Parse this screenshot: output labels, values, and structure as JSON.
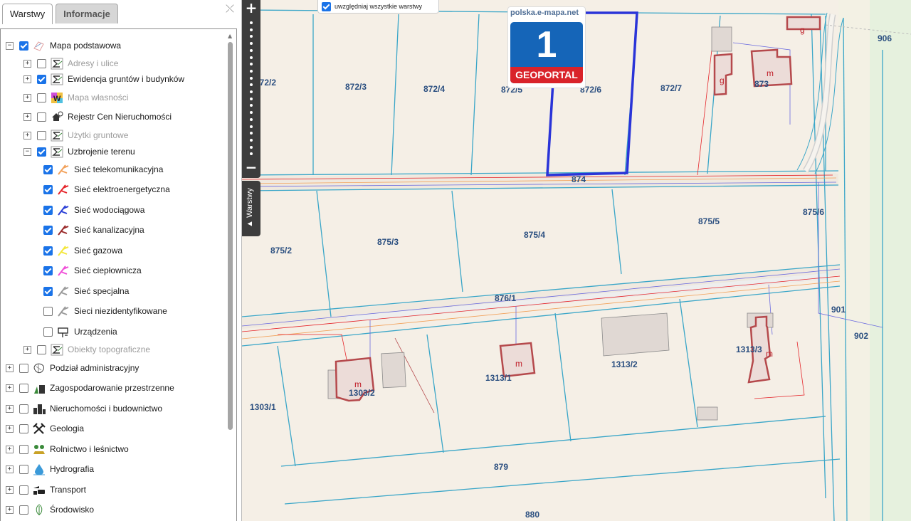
{
  "tabs": {
    "layers": "Warstwy",
    "info": "Informacje"
  },
  "tree": [
    {
      "label": "Mapa podstawowa",
      "checked": true,
      "expander": "−",
      "icon": "base-map-icon",
      "dim": false,
      "level": 0
    },
    {
      "label": "Adresy i ulice",
      "checked": false,
      "expander": "+",
      "icon": "sigma-icon",
      "dim": true,
      "level": 1
    },
    {
      "label": "Ewidencja gruntów i budynków",
      "checked": true,
      "expander": "+",
      "icon": "sigma-icon",
      "dim": false,
      "level": 1
    },
    {
      "label": "Mapa własności",
      "checked": false,
      "expander": "+",
      "icon": "ownership-w-icon",
      "dim": true,
      "level": 1
    },
    {
      "label": "Rejestr Cen Nieruchomości",
      "checked": false,
      "expander": "+",
      "icon": "house-price-icon",
      "dim": false,
      "level": 1
    },
    {
      "label": "Użytki gruntowe",
      "checked": false,
      "expander": "+",
      "icon": "sigma-icon",
      "dim": true,
      "level": 1
    },
    {
      "label": "Uzbrojenie terenu",
      "checked": true,
      "expander": "−",
      "icon": "sigma-icon",
      "dim": false,
      "level": 1
    },
    {
      "label": "Sieć telekomunikacyjna",
      "checked": true,
      "expander": "",
      "icon": "network-icon",
      "color": "#f2a15a",
      "dim": false,
      "level": 2
    },
    {
      "label": "Sieć elektroenergetyczna",
      "checked": true,
      "expander": "",
      "icon": "network-icon",
      "color": "#e5252a",
      "dim": false,
      "level": 2
    },
    {
      "label": "Sieć wodociągowa",
      "checked": true,
      "expander": "",
      "icon": "network-icon",
      "color": "#2a3fd6",
      "dim": false,
      "level": 2
    },
    {
      "label": "Sieć kanalizacyjna",
      "checked": true,
      "expander": "",
      "icon": "network-icon",
      "color": "#9a2a2a",
      "dim": false,
      "level": 2
    },
    {
      "label": "Sieć gazowa",
      "checked": true,
      "expander": "",
      "icon": "network-icon",
      "color": "#f3e63a",
      "dim": false,
      "level": 2
    },
    {
      "label": "Sieć ciepłownicza",
      "checked": true,
      "expander": "",
      "icon": "network-icon",
      "color": "#f04fd8",
      "dim": false,
      "level": 2
    },
    {
      "label": "Sieć specjalna",
      "checked": true,
      "expander": "",
      "icon": "network-icon",
      "color": "#9a9a9a",
      "dim": false,
      "level": 2
    },
    {
      "label": "Sieci niezidentyfikowane",
      "checked": false,
      "expander": "",
      "icon": "network-icon",
      "color": "#9a9a9a",
      "dim": false,
      "level": 2
    },
    {
      "label": "Urządzenia",
      "checked": false,
      "expander": "",
      "icon": "device-icon",
      "dim": false,
      "level": 2
    },
    {
      "label": "Obiekty topograficzne",
      "checked": false,
      "expander": "+",
      "icon": "sigma-icon",
      "dim": true,
      "level": 1
    },
    {
      "label": "Podział administracyjny",
      "checked": false,
      "expander": "+",
      "icon": "admin-division-icon",
      "dim": false,
      "level": 0
    },
    {
      "label": "Zagospodarowanie przestrzenne",
      "checked": false,
      "expander": "+",
      "icon": "spatial-planning-icon",
      "dim": false,
      "level": 0
    },
    {
      "label": "Nieruchomości i budownictwo",
      "checked": false,
      "expander": "+",
      "icon": "buildings-icon",
      "dim": false,
      "level": 0
    },
    {
      "label": "Geologia",
      "checked": false,
      "expander": "+",
      "icon": "hammers-icon",
      "dim": false,
      "level": 0
    },
    {
      "label": "Rolnictwo i leśnictwo",
      "checked": false,
      "expander": "+",
      "icon": "trees-icon",
      "dim": false,
      "level": 0
    },
    {
      "label": "Hydrografia",
      "checked": false,
      "expander": "+",
      "icon": "water-drop-icon",
      "dim": false,
      "level": 0
    },
    {
      "label": "Transport",
      "checked": false,
      "expander": "+",
      "icon": "transport-icon",
      "dim": false,
      "level": 0
    },
    {
      "label": "Środowisko",
      "checked": false,
      "expander": "+",
      "icon": "leaf-icon",
      "dim": false,
      "level": 0
    }
  ],
  "map_controls": {
    "zoom_in": "+",
    "zoom_out": "−",
    "layers_toggle": "▲ Warstwy"
  },
  "logo": {
    "url": "polska.e-mapa.net",
    "number": "1",
    "brand": "GEOPORTAL"
  },
  "all_layers": {
    "label": "uwzględniaj wszystkie warstwy",
    "checked": true
  },
  "parcels": [
    "872/2",
    "872/3",
    "872/4",
    "872/5",
    "872/6",
    "872/7",
    "873",
    "874",
    "875/2",
    "875/3",
    "875/4",
    "875/5",
    "875/6",
    "876/1",
    "901",
    "902",
    "906",
    "1303/1",
    "1303/2",
    "1313/1",
    "1313/2",
    "1313/3",
    "879",
    "880"
  ],
  "building_marks": {
    "g": "g",
    "m": "m"
  },
  "colors": {
    "selected_parcel": "#2a34d8",
    "parcel_lines": "#3aa6c8",
    "building": "#b5494c",
    "map_bg": "#f5efe6",
    "forest": "#e6f1de"
  }
}
